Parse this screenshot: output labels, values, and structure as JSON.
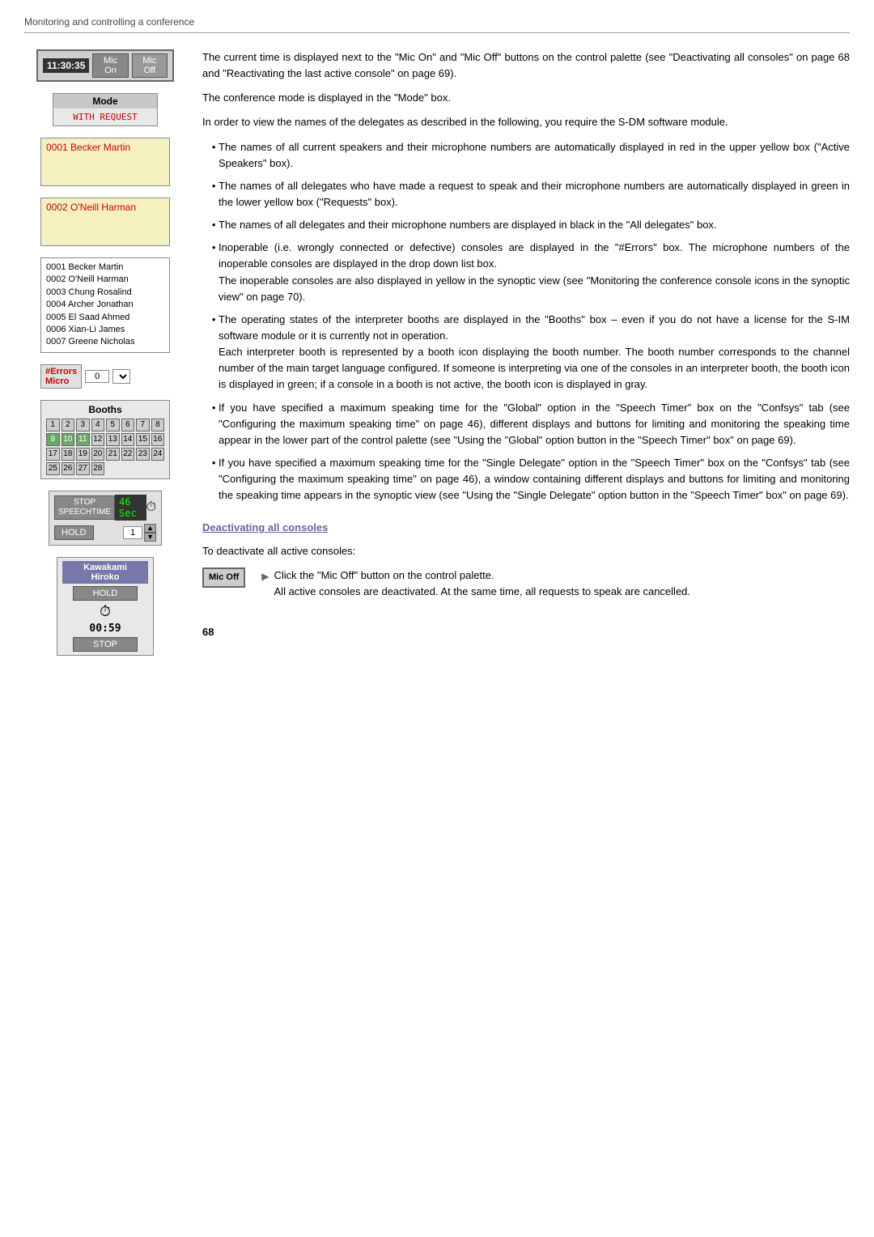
{
  "header": {
    "title": "Monitoring and controlling a conference"
  },
  "page_number": "68",
  "control_palette": {
    "time": "11:30:35",
    "mic_on_label": "Mic On",
    "mic_off_label": "Mic Off"
  },
  "mode_box": {
    "label": "Mode",
    "value": "WITH REQUEST"
  },
  "active_speakers": [
    {
      "name": "0001 Becker Martin"
    },
    {
      "name": "0002 O'Neill Harman"
    }
  ],
  "delegates": {
    "list": [
      "0001 Becker Martin",
      "0002 O'Neill Harman",
      "0003 Chung Rosalind",
      "0004 Archer Jonathan",
      "0005 El Saad Ahmed",
      "0006 Xian-Li James",
      "0007 Greene Nicholas"
    ]
  },
  "errors": {
    "label": "#Errors",
    "micro_label": "Micro",
    "value": "0"
  },
  "booths": {
    "label": "Booths",
    "cells": [
      "1",
      "2",
      "3",
      "4",
      "5",
      "6",
      "7",
      "8",
      "9",
      "10",
      "11",
      "12",
      "13",
      "14",
      "15",
      "16",
      "17",
      "18",
      "19",
      "20",
      "21",
      "22",
      "23",
      "24",
      "25",
      "26",
      "27",
      "28"
    ],
    "active_indices": [
      8,
      9,
      10
    ],
    "row1": [
      1,
      2,
      3,
      4,
      5,
      6,
      7,
      8
    ],
    "row2": [
      9,
      10,
      11,
      12,
      13,
      14,
      15,
      16
    ],
    "row3": [
      17,
      18,
      19,
      20,
      21,
      22,
      23,
      24
    ],
    "row4": [
      25,
      26,
      27,
      28
    ]
  },
  "speech_timer": {
    "stop_label": "STOP\nSPEECHTIME",
    "hold_label": "HOLD",
    "timer_value": "46 Sec",
    "hold_number": "1"
  },
  "delegate_timer": {
    "name_line1": "Kawakami",
    "name_line2": "Hiroko",
    "hold_label": "HOLD",
    "time_value": "00:59",
    "stop_label": "STOP"
  },
  "text": {
    "para1": "The current time is displayed next to the \"Mic On\" and \"Mic Off\" buttons on the control palette (see \"Deactivating all consoles\" on page 68 and \"Reactivating the last active console\" on page 69).",
    "para2": "The conference mode is displayed in the \"Mode\" box.",
    "para3": "In order to view the names of the delegates as described in the following, you require the S-DM software module.",
    "bullet1": "The names of all current speakers and their microphone numbers are automatically displayed in red in the upper yellow box (\"Active Speakers\" box).",
    "bullet2": "The names of all delegates who have made a request to speak and their microphone numbers are automatically displayed in green in the lower yellow box (\"Requests\" box).",
    "bullet3": "The names of all delegates and their microphone numbers are displayed in black in the \"All delegates\" box.",
    "bullet4": "Inoperable (i.e. wrongly connected or defective) consoles are displayed in the \"#Errors\" box. The microphone numbers of the inoperable consoles are displayed in the drop down list box.\nThe inoperable consoles are also displayed in yellow in the synoptic view (see \"Monitoring the conference console icons in the synoptic view\" on page 70).",
    "bullet5": "The operating states of the interpreter booths are displayed in the \"Booths\" box – even if you do not have a license for the S-IM software module or it is currently not in operation.\nEach interpreter booth is represented by a booth icon displaying the booth number. The booth number corresponds to the channel number of the main target language configured. If someone is interpreting via one of the consoles in an interpreter booth, the booth icon is displayed in green; if a console in a booth is not active, the booth icon is displayed in gray.",
    "bullet6": "If you have specified a maximum speaking time for the \"Global\" option in the \"Speech Timer\" box on the \"Confsys\" tab (see \"Configuring the maximum speaking time\" on page 46), different displays and buttons for limiting and monitoring the speaking time appear in the lower part of the control palette (see \"Using the \\\"Global\\\" option button in the \\\"Speech Timer\\\" box\" on page 69).",
    "bullet7": "If you have specified a maximum speaking time for the \"Single Delegate\" option in the \"Speech Timer\" box on the \"Confsys\" tab (see \"Configuring the maximum speaking time\" on page 46), a window containing different displays and buttons for limiting and monitoring the speaking time appears in the synoptic view (see \"Using the \\\"Single Delegate\\\" option button in the \\\"Speech Timer\\\" box\" on page 69).",
    "section_heading": "Deactivating all consoles",
    "deactivate_intro": "To deactivate all active consoles:",
    "step1_a": "Click the \"Mic Off\" button on the control palette.",
    "step1_b": "All active consoles are deactivated. At the same time, all requests to speak are cancelled."
  },
  "mic_off_btn": {
    "label": "Mic Off"
  }
}
